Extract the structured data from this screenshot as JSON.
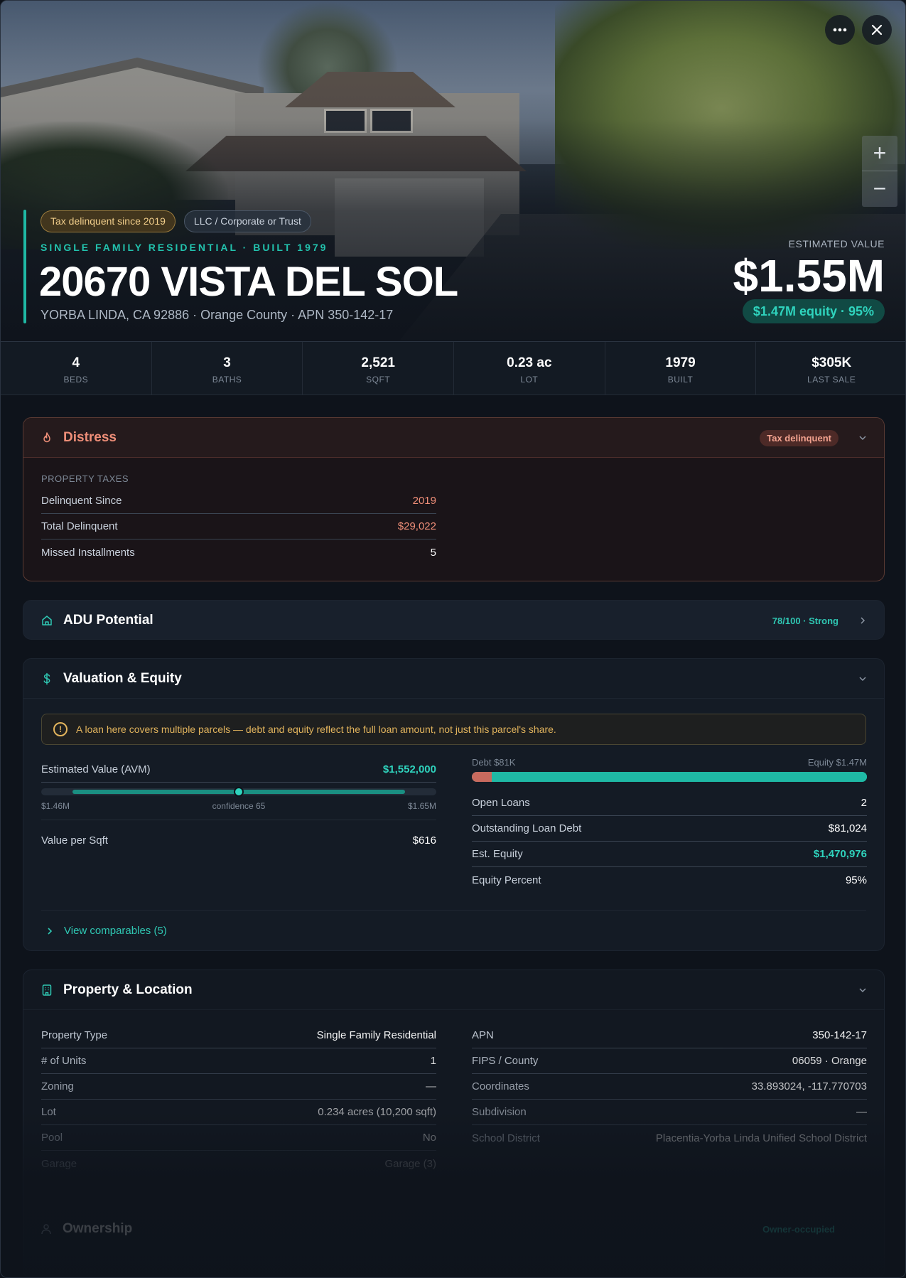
{
  "header": {
    "more_icon": "more-horizontal-icon",
    "close_icon": "close-icon",
    "zoom_in": "+",
    "zoom_out": "−",
    "chips": [
      "Tax delinquent since 2019",
      "LLC / Corporate or Trust"
    ],
    "subtitle": "SINGLE FAMILY RESIDENTIAL · BUILT 1979",
    "address": "20670 VISTA DEL SOL",
    "location": "YORBA LINDA, CA 92886 · Orange County · APN 350-142-17",
    "estimated_value_label": "ESTIMATED VALUE",
    "estimated_value": "$1.55M",
    "equity_pill": "$1.47M equity · 95%"
  },
  "stats": [
    {
      "value": "4",
      "label": "BEDS"
    },
    {
      "value": "3",
      "label": "BATHS"
    },
    {
      "value": "2,521",
      "label": "SQFT"
    },
    {
      "value": "0.23 ac",
      "label": "LOT"
    },
    {
      "value": "1979",
      "label": "BUILT"
    },
    {
      "value": "$305K",
      "label": "LAST SALE"
    }
  ],
  "distress": {
    "title": "Distress",
    "badge": "Tax delinquent",
    "section_label": "PROPERTY TAXES",
    "rows": [
      {
        "k": "Delinquent Since",
        "v": "2019"
      },
      {
        "k": "Total Delinquent",
        "v": "$29,022"
      },
      {
        "k": "Missed Installments",
        "v": "5"
      }
    ]
  },
  "adu": {
    "title": "ADU Potential",
    "score": "78/100 · Strong"
  },
  "valuation": {
    "title": "Valuation & Equity",
    "warning": "A loan here covers multiple parcels — debt and equity reflect the full loan amount, not just this parcel's share.",
    "avm_label": "Estimated Value (AVM)",
    "avm_value": "$1,552,000",
    "range_low": "$1.46M",
    "confidence": "confidence 65",
    "range_high": "$1.65M",
    "avm_marker_fraction": 0.5,
    "value_per_sqft_label": "Value per Sqft",
    "value_per_sqft": "$616",
    "debt_label": "Debt $81K",
    "equity_label": "Equity $1.47M",
    "debt_fraction": 0.05,
    "rows": [
      {
        "k": "Open Loans",
        "v": "2"
      },
      {
        "k": "Outstanding Loan Debt",
        "v": "$81,024"
      },
      {
        "k": "Est. Equity",
        "v": "$1,470,976"
      },
      {
        "k": "Equity Percent",
        "v": "95%"
      }
    ],
    "comparables_link": "View comparables (5)"
  },
  "property": {
    "title": "Property & Location",
    "left_rows": [
      {
        "k": "Property Type",
        "v": "Single Family Residential"
      },
      {
        "k": "# of Units",
        "v": "1"
      },
      {
        "k": "Zoning",
        "v": "—"
      },
      {
        "k": "Lot",
        "v": "0.234 acres (10,200 sqft)"
      },
      {
        "k": "Pool",
        "v": "No"
      },
      {
        "k": "Garage",
        "v": "Garage (3)"
      }
    ],
    "right_rows": [
      {
        "k": "APN",
        "v": "350-142-17"
      },
      {
        "k": "FIPS / County",
        "v": "06059 · Orange"
      },
      {
        "k": "Coordinates",
        "v": "33.893024, -117.770703"
      },
      {
        "k": "Subdivision",
        "v": "—"
      },
      {
        "k": "School District",
        "v": "Placentia-Yorba Linda Unified School District"
      }
    ]
  },
  "ownership": {
    "title": "Ownership",
    "status": "Owner-occupied"
  },
  "colors": {
    "accent": "#1fb9a5",
    "distress": "#ee8e78",
    "warning": "#e2b45d",
    "debt": "#c86a5e"
  }
}
